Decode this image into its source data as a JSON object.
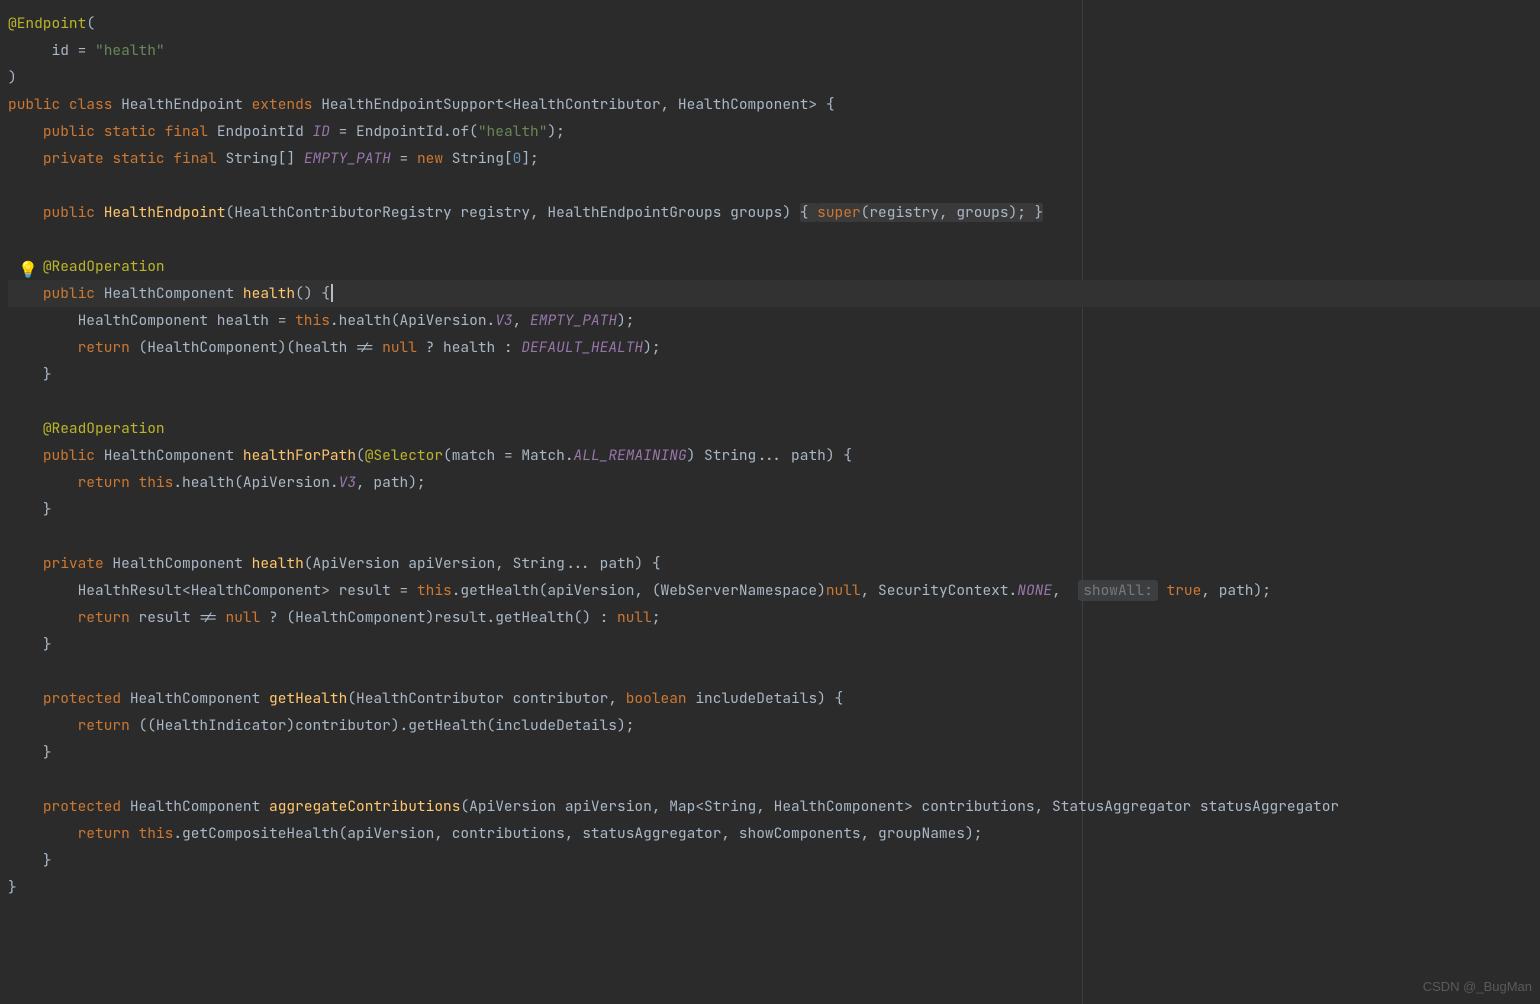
{
  "watermark": "CSDN @_BugMan",
  "hint_showAll": "showAll:",
  "code": {
    "l1": {
      "ann": "@Endpoint",
      "p1": "("
    },
    "l2": {
      "key": "id",
      "eq": " = ",
      "str": "\"health\""
    },
    "l3": {
      "p1": ")"
    },
    "l4": {
      "kw1": "public class ",
      "cls": "HealthEndpoint ",
      "kw2": "extends ",
      "sup": "HealthEndpointSupport<HealthContributor, HealthComponent> {"
    },
    "l5": {
      "kw": "public static final ",
      "t": "EndpointId ",
      "f": "ID",
      "eq": " = ",
      "call": "EndpointId.of(",
      "str": "\"health\"",
      "end": ");"
    },
    "l6": {
      "kw": "private static final ",
      "t": "String[] ",
      "f": "EMPTY_PATH",
      "eq": " = ",
      "kw2": "new ",
      "t2": "String[",
      "num": "0",
      "end": "];"
    },
    "l8": {
      "kw": "public ",
      "ctor": "HealthEndpoint",
      "params": "(HealthContributorRegistry registry, HealthEndpointGroups groups) ",
      "ob": "{ ",
      "kw2": "super",
      "args": "(registry, groups); ",
      "cb": "}"
    },
    "l10": {
      "ann": "@ReadOperation"
    },
    "l11": {
      "kw": "public ",
      "ret": "HealthComponent ",
      "m": "health",
      "p": "() {"
    },
    "l12": {
      "t": "HealthComponent health = ",
      "kw": "this",
      "dot": ".health(ApiVersion.",
      "c": "V3",
      "comma": ", ",
      "c2": "EMPTY_PATH",
      "end": ");"
    },
    "l13": {
      "kw": "return ",
      "p1": "(HealthComponent)(health != ",
      "kw2": "null ",
      "p2": "? health : ",
      "c": "DEFAULT_HEALTH",
      "end": ");"
    },
    "l14": {
      "b": "}"
    },
    "l16": {
      "ann": "@ReadOperation"
    },
    "l17": {
      "kw": "public ",
      "ret": "HealthComponent ",
      "m": "healthForPath",
      "p1": "(",
      "ann": "@Selector",
      "p2": "(match = Match.",
      "c": "ALL_REMAINING",
      "p3": ") String... path) {"
    },
    "l18": {
      "kw": "return this",
      "dot": ".health(ApiVersion.",
      "c": "V3",
      "end": ", path);"
    },
    "l19": {
      "b": "}"
    },
    "l21": {
      "kw": "private ",
      "ret": "HealthComponent ",
      "m": "health",
      "p": "(ApiVersion apiVersion, String... path) {"
    },
    "l22": {
      "t": "HealthResult<HealthComponent> result = ",
      "kw": "this",
      "dot": ".getHealth(apiVersion, (WebServerNamespace)",
      "kw2": "null",
      "p2": ", SecurityContext.",
      "c": "NONE",
      "comma": ", ",
      "kw3": "true",
      "end": ", path);"
    },
    "l23": {
      "kw": "return ",
      "p1": "result != ",
      "kw2": "null ",
      "p2": "? (HealthComponent)result.getHealth() : ",
      "kw3": "null",
      "end": ";"
    },
    "l24": {
      "b": "}"
    },
    "l26": {
      "kw": "protected ",
      "ret": "HealthComponent ",
      "m": "getHealth",
      "p": "(HealthContributor contributor, ",
      "kw2": "boolean ",
      "p2": "includeDetails) {"
    },
    "l27": {
      "kw": "return ",
      "p": "((HealthIndicator)contributor).getHealth(includeDetails);"
    },
    "l28": {
      "b": "}"
    },
    "l30": {
      "kw": "protected ",
      "ret": "HealthComponent ",
      "m": "aggregateContributions",
      "p": "(ApiVersion apiVersion, Map<String, HealthComponent> contributions, StatusAggregator statusAggregator"
    },
    "l31": {
      "kw": "return this",
      "dot": ".getCompositeHealth(apiVersion, contributions, statusAggregator, showComponents, groupNames);"
    },
    "l32": {
      "b": "}"
    },
    "l33": {
      "b": "}"
    }
  }
}
